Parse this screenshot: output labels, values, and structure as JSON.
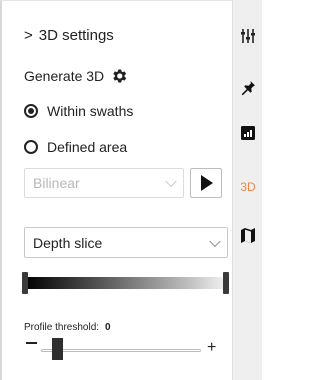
{
  "panel": {
    "header": {
      "chevron": ">",
      "title": "3D settings"
    },
    "generate": {
      "label": "Generate 3D",
      "icon": "gear-icon"
    },
    "radios": [
      {
        "label": "Within swaths",
        "selected": true
      },
      {
        "label": "Defined area",
        "selected": false
      }
    ],
    "interpolation": {
      "value": "Bilinear",
      "disabled": true
    },
    "play_icon": "play-icon",
    "display_mode": {
      "value": "Depth slice"
    },
    "gradient_range": {
      "min": 0,
      "max": 1
    },
    "profile_threshold": {
      "label": "Profile threshold:",
      "value": "0",
      "slider_fraction": 0.05
    },
    "minus": "−",
    "plus": "+"
  },
  "rail": {
    "items": [
      {
        "icon": "sliders-icon"
      },
      {
        "icon": "pin-icon"
      },
      {
        "icon": "chart-icon"
      },
      {
        "label": "3D",
        "active_color": "#e8894a"
      },
      {
        "icon": "map-icon"
      }
    ]
  }
}
